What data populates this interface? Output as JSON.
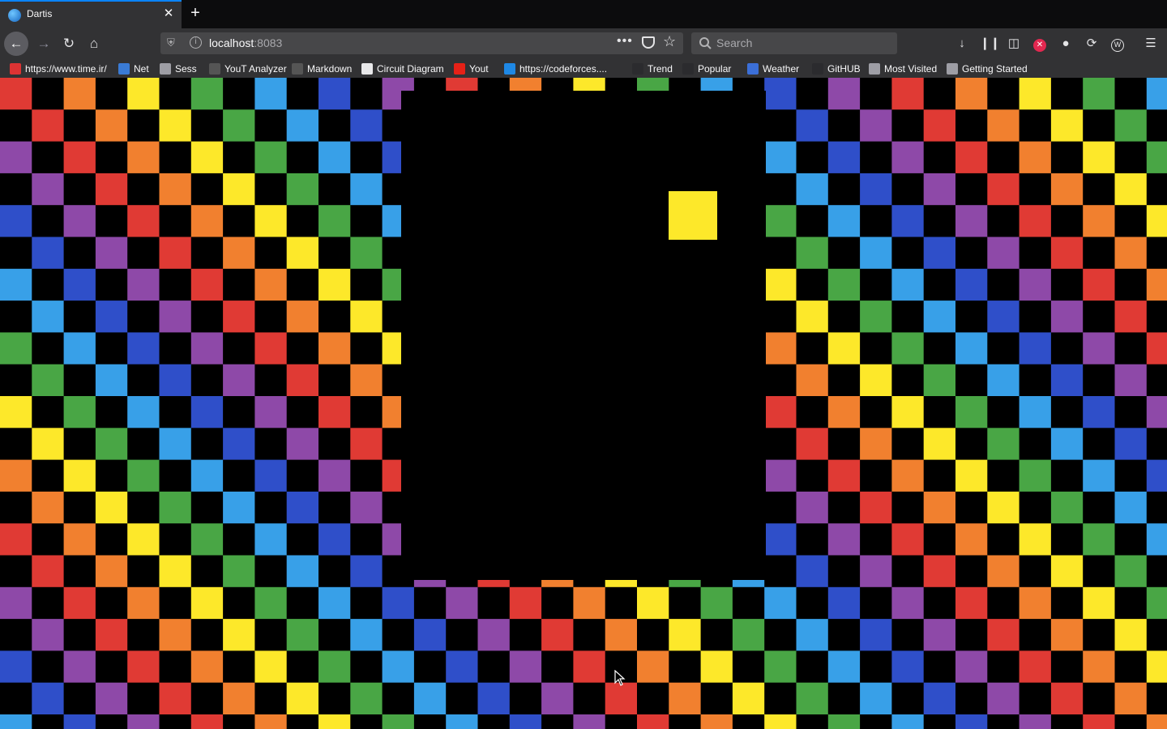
{
  "browser": {
    "tab": {
      "title": "Dartis",
      "close_glyph": "✕"
    },
    "newtab_glyph": "+",
    "address": {
      "host": "localhost",
      "port": ":8083"
    },
    "search": {
      "placeholder": "Search"
    },
    "bookmarks": [
      {
        "label": "https://www.time.ir/",
        "icon": "time-ir-icon",
        "color": "#d33"
      },
      {
        "label": "Net",
        "icon": "globe-blue-icon",
        "color": "#3a7bd5"
      },
      {
        "label": "Sess",
        "icon": "globe-icon",
        "color": "#9e9ea5"
      },
      {
        "label": "YouT Analyzer",
        "icon": "dot-icon",
        "color": "#555"
      },
      {
        "label": "Markdown",
        "icon": "markdown-icon",
        "color": "#555"
      },
      {
        "label": "Circuit Diagram",
        "icon": "document-icon",
        "color": "#e8e8ea"
      },
      {
        "label": "Yout",
        "icon": "youtube-icon",
        "color": "#e62117"
      },
      {
        "label": "https://codeforces....",
        "icon": "codeforces-icon",
        "color": "#1e88e5"
      },
      {
        "label": "Trend",
        "icon": "github-icon",
        "color": "#2b2b2e"
      },
      {
        "label": "Popular",
        "icon": "github-icon",
        "color": "#2b2b2e"
      },
      {
        "label": "Weather",
        "icon": "weather-icon",
        "color": "#3b6fd8"
      },
      {
        "label": "GitHUB",
        "icon": "github-icon",
        "color": "#2b2b2e"
      },
      {
        "label": "Most Visited",
        "icon": "gear-icon",
        "color": "#9e9ea5"
      },
      {
        "label": "Getting Started",
        "icon": "globe-icon",
        "color": "#9e9ea5"
      }
    ]
  },
  "game": {
    "palette": [
      "#e03a34",
      "#f1802f",
      "#fde82a",
      "#49a645",
      "#38a0e8",
      "#2f4fc9",
      "#8e49a8"
    ],
    "background": "#000000",
    "food_color": "#fde82a"
  }
}
